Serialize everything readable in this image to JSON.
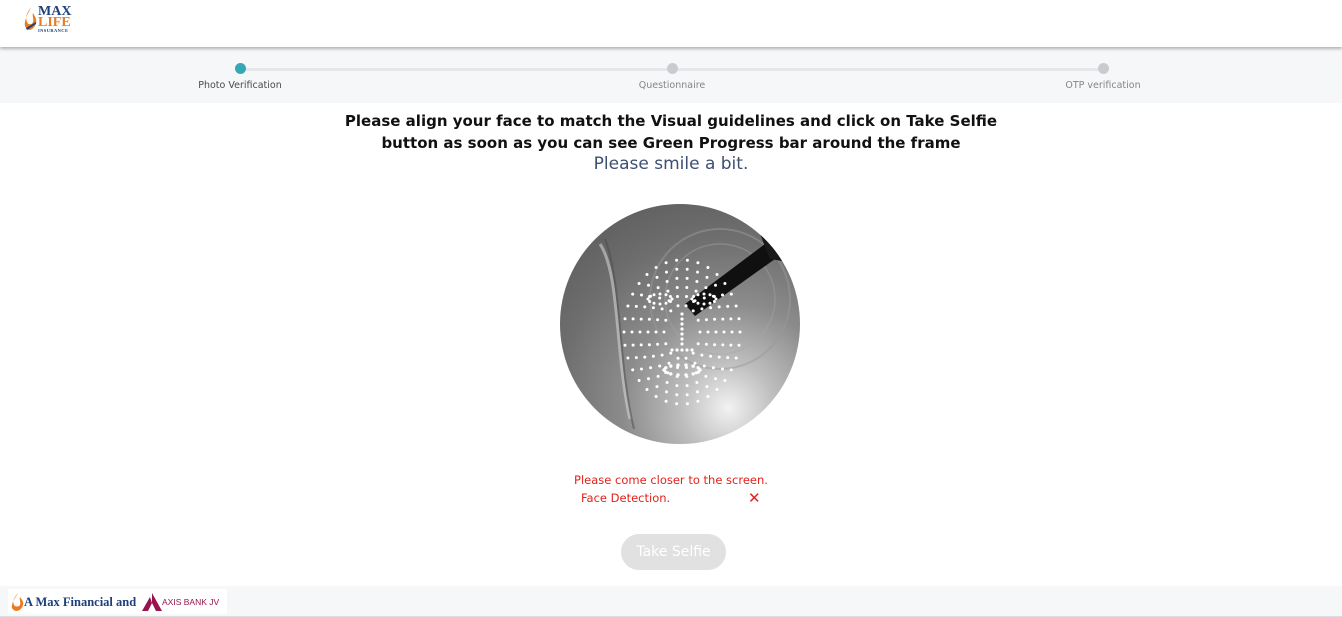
{
  "brand": {
    "logo_line1": "MAX",
    "logo_line2": "LIFE",
    "logo_line3": "INSURANCE",
    "accent_orange": "#e77c24",
    "brand_blue": "#1d3f7a"
  },
  "stepper": {
    "steps": [
      {
        "label": "Photo Verification",
        "active": true
      },
      {
        "label": "Questionnaire",
        "active": false
      },
      {
        "label": "OTP verification",
        "active": false
      }
    ],
    "active_color": "#35a7b5"
  },
  "instructions": {
    "line1": "Please align your face to match the Visual guidelines and click on Take Selfie",
    "line2": "button as soon as you can see Green Progress bar around the frame",
    "smile": "Please smile a bit."
  },
  "camera": {
    "icon": "face-mesh-overlay"
  },
  "status": {
    "closer": "Please come closer to the screen.",
    "face_detection": "Face Detection.",
    "face_detection_icon": "cross-icon",
    "error_color": "#e2231a"
  },
  "actions": {
    "take_selfie": "Take Selfie"
  },
  "footer": {
    "text": "A Max Financial and",
    "axis": "AXIS BANK JV"
  }
}
